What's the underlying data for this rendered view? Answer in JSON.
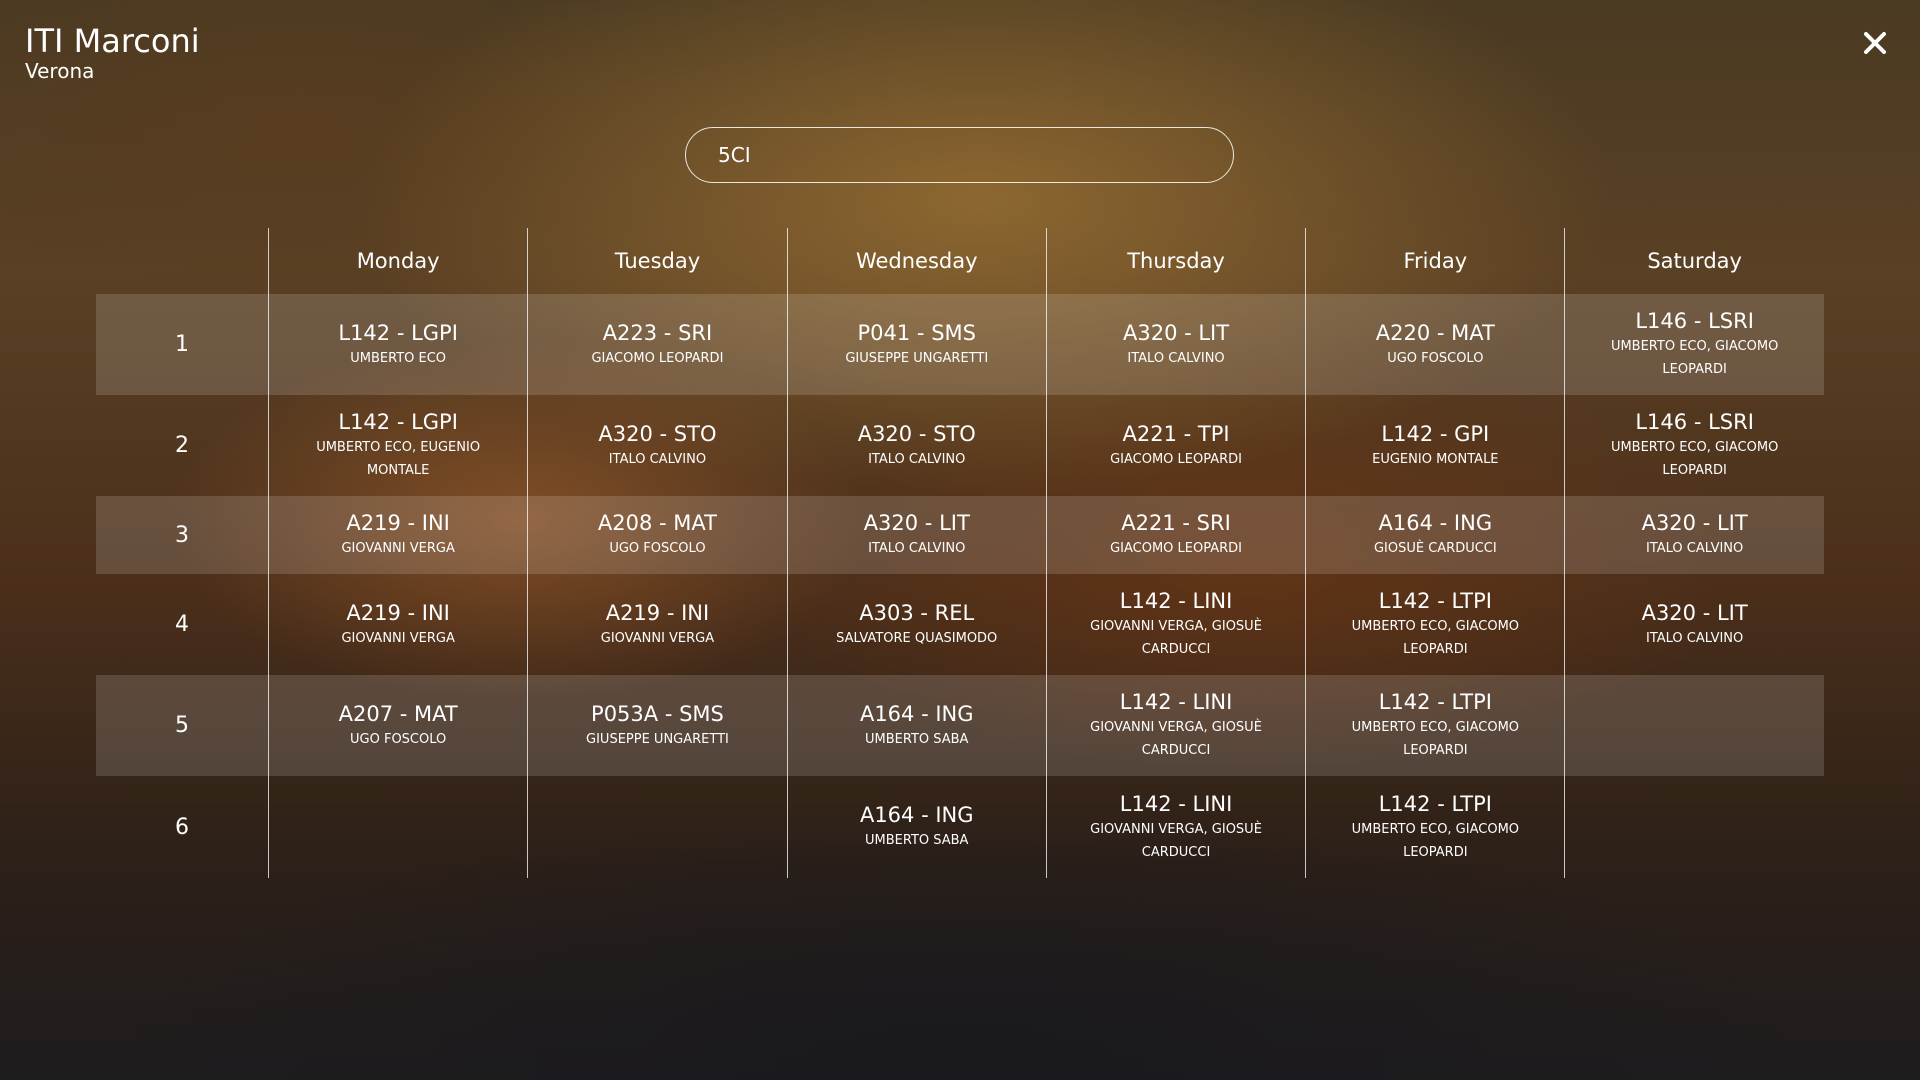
{
  "header": {
    "school_name": "ITI Marconi",
    "city": "Verona"
  },
  "search": {
    "value": "5CI",
    "placeholder": ""
  },
  "timetable": {
    "days": [
      "Monday",
      "Tuesday",
      "Wednesday",
      "Thursday",
      "Friday",
      "Saturday"
    ],
    "periods": [
      {
        "num": "1",
        "lessons": [
          {
            "room_subject": "L142 - LGPI",
            "teacher": "UMBERTO ECO"
          },
          {
            "room_subject": "A223 - SRI",
            "teacher": "GIACOMO LEOPARDI"
          },
          {
            "room_subject": "P041 - SMS",
            "teacher": "GIUSEPPE UNGARETTI"
          },
          {
            "room_subject": "A320 - LIT",
            "teacher": "ITALO CALVINO"
          },
          {
            "room_subject": "A220 - MAT",
            "teacher": "UGO FOSCOLO"
          },
          {
            "room_subject": "L146 - LSRI",
            "teacher": "UMBERTO ECO, GIACOMO LEOPARDI"
          }
        ]
      },
      {
        "num": "2",
        "lessons": [
          {
            "room_subject": "L142 - LGPI",
            "teacher": "UMBERTO ECO, EUGENIO MONTALE"
          },
          {
            "room_subject": "A320 - STO",
            "teacher": "ITALO CALVINO"
          },
          {
            "room_subject": "A320 - STO",
            "teacher": "ITALO CALVINO"
          },
          {
            "room_subject": "A221 - TPI",
            "teacher": "GIACOMO LEOPARDI"
          },
          {
            "room_subject": "L142 - GPI",
            "teacher": "EUGENIO MONTALE"
          },
          {
            "room_subject": "L146 - LSRI",
            "teacher": "UMBERTO ECO, GIACOMO LEOPARDI"
          }
        ]
      },
      {
        "num": "3",
        "lessons": [
          {
            "room_subject": "A219 - INI",
            "teacher": "GIOVANNI VERGA"
          },
          {
            "room_subject": "A208 - MAT",
            "teacher": "UGO FOSCOLO"
          },
          {
            "room_subject": "A320 - LIT",
            "teacher": "ITALO CALVINO"
          },
          {
            "room_subject": "A221 - SRI",
            "teacher": "GIACOMO LEOPARDI"
          },
          {
            "room_subject": "A164 - ING",
            "teacher": "GIOSUÈ CARDUCCI"
          },
          {
            "room_subject": "A320 - LIT",
            "teacher": "ITALO CALVINO"
          }
        ]
      },
      {
        "num": "4",
        "lessons": [
          {
            "room_subject": "A219 - INI",
            "teacher": "GIOVANNI VERGA"
          },
          {
            "room_subject": "A219 - INI",
            "teacher": "GIOVANNI VERGA"
          },
          {
            "room_subject": "A303 - REL",
            "teacher": "SALVATORE QUASIMODO"
          },
          {
            "room_subject": "L142 - LINI",
            "teacher": "GIOVANNI VERGA, GIOSUÈ CARDUCCI"
          },
          {
            "room_subject": "L142 - LTPI",
            "teacher": "UMBERTO ECO, GIACOMO LEOPARDI"
          },
          {
            "room_subject": "A320 - LIT",
            "teacher": "ITALO CALVINO"
          }
        ]
      },
      {
        "num": "5",
        "lessons": [
          {
            "room_subject": "A207 - MAT",
            "teacher": "UGO FOSCOLO"
          },
          {
            "room_subject": "P053A - SMS",
            "teacher": "GIUSEPPE UNGARETTI"
          },
          {
            "room_subject": "A164 - ING",
            "teacher": "UMBERTO SABA"
          },
          {
            "room_subject": "L142 - LINI",
            "teacher": "GIOVANNI VERGA, GIOSUÈ CARDUCCI"
          },
          {
            "room_subject": "L142 - LTPI",
            "teacher": "UMBERTO ECO, GIACOMO LEOPARDI"
          },
          {
            "room_subject": "",
            "teacher": ""
          }
        ]
      },
      {
        "num": "6",
        "lessons": [
          {
            "room_subject": "",
            "teacher": ""
          },
          {
            "room_subject": "",
            "teacher": ""
          },
          {
            "room_subject": "A164 - ING",
            "teacher": "UMBERTO SABA"
          },
          {
            "room_subject": "L142 - LINI",
            "teacher": "GIOVANNI VERGA, GIOSUÈ CARDUCCI"
          },
          {
            "room_subject": "L142 - LTPI",
            "teacher": "UMBERTO ECO, GIACOMO LEOPARDI"
          },
          {
            "room_subject": "",
            "teacher": ""
          }
        ]
      }
    ]
  }
}
